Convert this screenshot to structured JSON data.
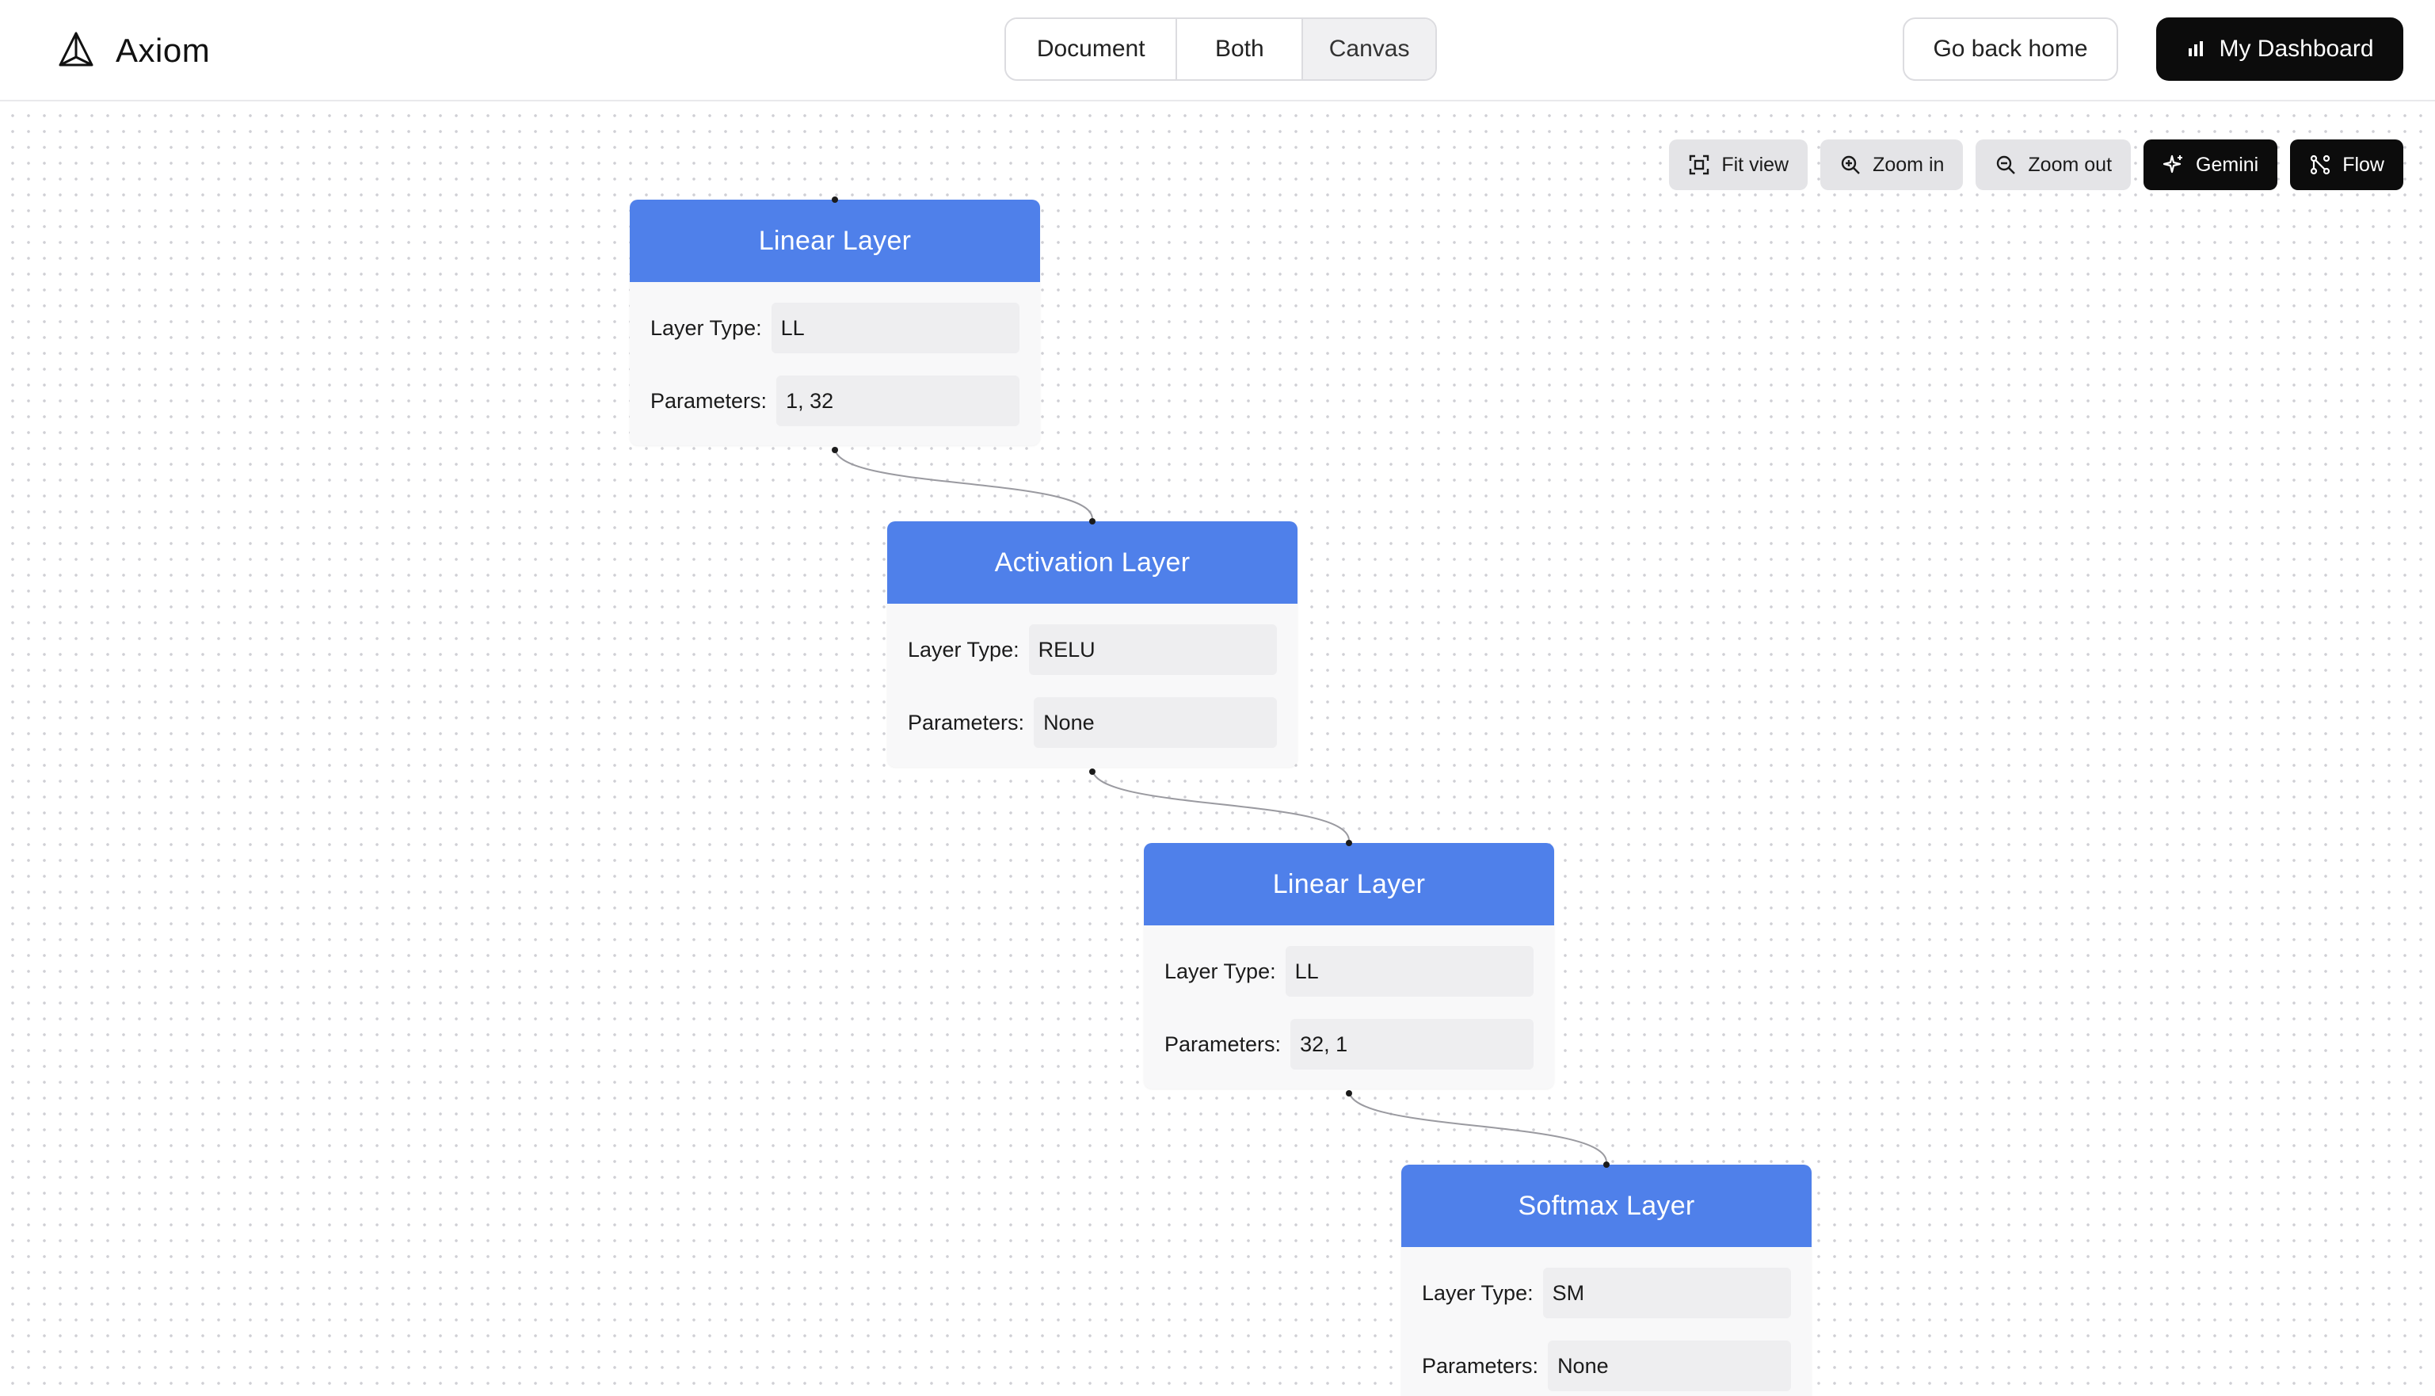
{
  "header": {
    "brand": "Axiom",
    "view_tabs": [
      "Document",
      "Both",
      "Canvas"
    ],
    "active_view": "Canvas",
    "home_button": "Go back home",
    "dashboard_button": "My Dashboard"
  },
  "toolbar": {
    "fit_view": "Fit view",
    "zoom_in": "Zoom in",
    "zoom_out": "Zoom out",
    "gemini": "Gemini",
    "flow": "Flow"
  },
  "nodes": [
    {
      "title": "Linear Layer",
      "type_label": "Layer Type:",
      "type_value": "LL",
      "params_label": "Parameters:",
      "params_value": "1, 32"
    },
    {
      "title": "Activation Layer",
      "type_label": "Layer Type:",
      "type_value": "RELU",
      "params_label": "Parameters:",
      "params_value": "None"
    },
    {
      "title": "Linear Layer",
      "type_label": "Layer Type:",
      "type_value": "LL",
      "params_label": "Parameters:",
      "params_value": "32, 1"
    },
    {
      "title": "Softmax Layer",
      "type_label": "Layer Type:",
      "type_value": "SM",
      "params_label": "Parameters:",
      "params_value": "None"
    }
  ],
  "colors": {
    "node_header": "#4f80ea",
    "primary_dark": "#0c0c0c",
    "active_tab_bg": "#f0f0f2"
  },
  "icons": {
    "brand": "axiom-logo-icon",
    "dashboard": "bar-chart-icon",
    "fit_view": "fit-view-icon",
    "zoom_in": "zoom-in-icon",
    "zoom_out": "zoom-out-icon",
    "gemini": "sparkle-icon",
    "flow": "flow-icon"
  }
}
